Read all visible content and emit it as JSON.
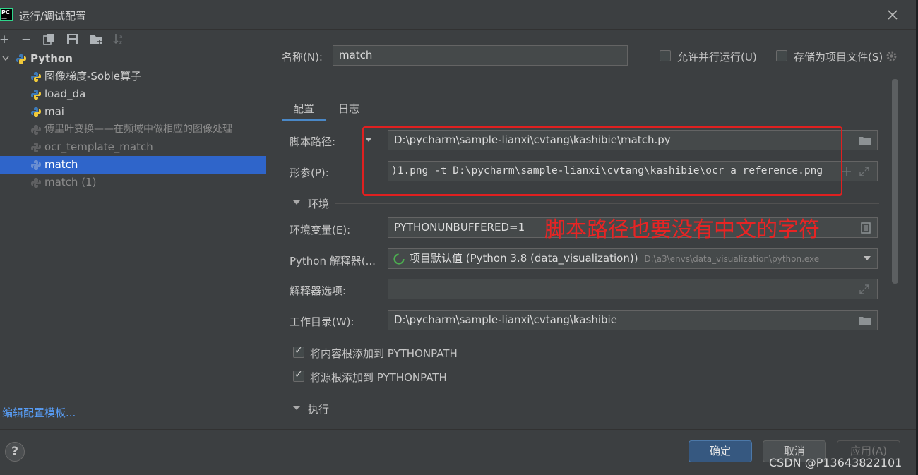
{
  "window": {
    "title": "运行/调试配置",
    "logo_text": [
      "PC",
      "—"
    ]
  },
  "left": {
    "root_label": "Python",
    "items": [
      {
        "label": "图像梯度-Soble算子",
        "dim": false
      },
      {
        "label": "load_da",
        "dim": false
      },
      {
        "label": "mai",
        "dim": false
      },
      {
        "label": "傅里叶变换——在频域中做相应的图像处理",
        "dim": true
      },
      {
        "label": "ocr_template_match",
        "dim": true
      },
      {
        "label": "match",
        "dim": false,
        "selected": true
      },
      {
        "label": "match (1)",
        "dim": true
      }
    ],
    "edit_templates": "编辑配置模板..."
  },
  "header": {
    "name_label": "名称(N):",
    "name_value": "match",
    "allow_parallel": "允许并行运行(U)",
    "store_as_project": "存储为项目文件(S)"
  },
  "tabs": {
    "config": "配置",
    "logs": "日志"
  },
  "form": {
    "script_path_label": "脚本路径:",
    "script_path_value": "D:\\pycharm\\sample-lianxi\\cvtang\\kashibie\\match.py",
    "params_label": "形参(P):",
    "params_value": ")1.png -t D:\\pycharm\\sample-lianxi\\cvtang\\kashibie\\ocr_a_reference.png",
    "env_section": "环境",
    "env_vars_label": "环境变量(E):",
    "env_vars_value": "PYTHONUNBUFFERED=1",
    "interpreter_label": "Python 解释器(...",
    "interpreter_value": "项目默认值 (Python 3.8 (data_visualization))",
    "interpreter_path": "D:\\a3\\envs\\data_visualization\\python.exe",
    "interp_options_label": "解释器选项:",
    "workdir_label": "工作目录(W):",
    "workdir_value": "D:\\pycharm\\sample-lianxi\\cvtang\\kashibie",
    "add_content_roots": "将内容根添加到 PYTHONPATH",
    "add_source_roots": "将源根添加到 PYTHONPATH",
    "exec_section": "执行"
  },
  "annotation": {
    "text": "脚本路径也要没有中文的字符",
    "color": "#e82424"
  },
  "buttons": {
    "help": "?",
    "ok": "确定",
    "cancel": "取消",
    "apply": "应用(A)"
  },
  "watermark": "CSDN @P13643822101",
  "colors": {
    "selection": "#2f65ca",
    "link": "#589df6",
    "accent": "#4a88c7"
  }
}
